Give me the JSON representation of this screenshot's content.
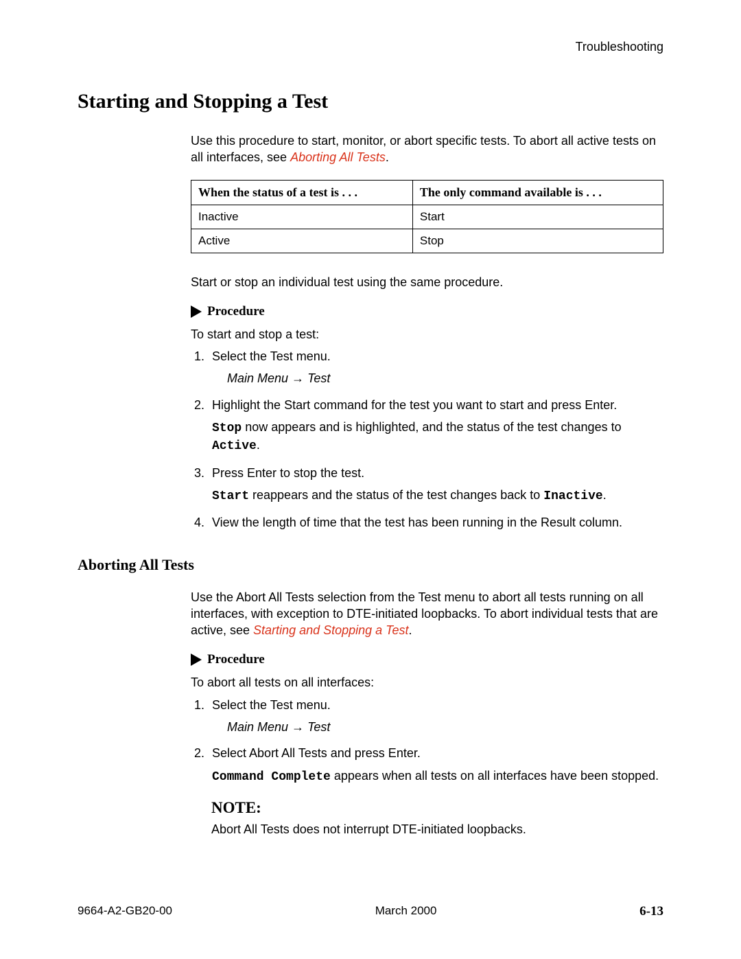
{
  "header": {
    "section": "Troubleshooting"
  },
  "h1": "Starting and Stopping a Test",
  "intro": {
    "pre": "Use this procedure to start, monitor, or abort specific tests. To abort all active tests on all interfaces, see ",
    "link": "Aborting All Tests",
    "post": "."
  },
  "table": {
    "head1": "When the status of a test is . . .",
    "head2": "The only command available is . . .",
    "rows": [
      {
        "c1": "Inactive",
        "c2": "Start"
      },
      {
        "c1": "Active",
        "c2": "Stop"
      }
    ]
  },
  "post_table": "Start or stop an individual test using the same procedure.",
  "procedure_label": "Procedure",
  "proc1": {
    "lead": "To start and stop a test:",
    "s1": "Select the Test menu.",
    "s1_path_a": "Main Menu ",
    "s1_path_arrow": "→",
    "s1_path_b": "Test",
    "s2": "Highlight the Start command for the test you want to start and press Enter.",
    "s2_sub_a": "Stop",
    "s2_sub_b": " now appears and is highlighted, and the status of the test changes to ",
    "s2_sub_c": "Active",
    "s2_sub_d": ".",
    "s3": "Press Enter to stop the test.",
    "s3_sub_a": "Start",
    "s3_sub_b": " reappears and the status of the test changes back to ",
    "s3_sub_c": "Inactive",
    "s3_sub_d": ".",
    "s4": "View the length of time that the test has been running in the Result column."
  },
  "h2": "Aborting All Tests",
  "abort_intro": {
    "pre": "Use the Abort All Tests selection from the Test menu to abort all tests running on all interfaces, with exception to DTE-initiated loopbacks. To abort individual tests that are active, see ",
    "link": "Starting and Stopping a Test",
    "post": "."
  },
  "proc2": {
    "lead": "To abort all tests on all interfaces:",
    "s1": "Select the Test menu.",
    "s1_path_a": "Main Menu ",
    "s1_path_arrow": "→",
    "s1_path_b": "Test",
    "s2": "Select Abort All Tests and press Enter.",
    "s2_sub_a": "Command Complete",
    "s2_sub_b": " appears when all tests on all interfaces have been stopped."
  },
  "note_head": "NOTE:",
  "note_body": "Abort All Tests does not interrupt DTE-initiated loopbacks.",
  "footer": {
    "doc": "9664-A2-GB20-00",
    "date": "March 2000",
    "page": "6-13"
  }
}
